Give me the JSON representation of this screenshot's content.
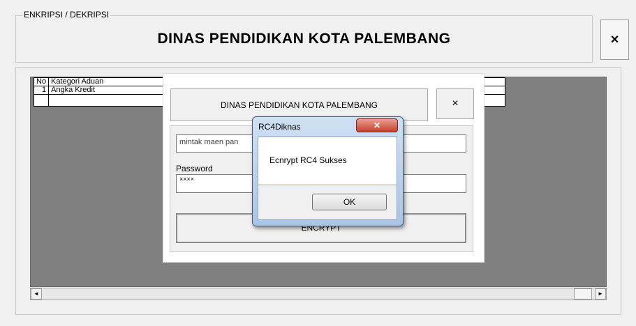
{
  "frame": {
    "legend": "ENKRIPSI / DEKRIPSI",
    "title": "DINAS PENDIDIKAN KOTA PALEMBANG",
    "close_label": "×"
  },
  "grid": {
    "headers": [
      "No",
      "Kategori Aduan"
    ],
    "rows": [
      {
        "no": "1",
        "kategori": "Angka Kredit"
      }
    ]
  },
  "scrollbar": {
    "left_arrow": "◄",
    "right_arrow": "►"
  },
  "inner_form": {
    "header": "DINAS PENDIDIKAN KOTA PALEMBANG",
    "close_label": "×",
    "plaintext_value": "mintak maen pan",
    "password_label": "Password",
    "password_value": "××××",
    "encrypt_label": "ENCRYPT"
  },
  "message_box": {
    "title": "RC4Diknas",
    "close_label": "✕",
    "message": "Ecnrypt RC4 Sukses",
    "ok_label": "OK"
  }
}
